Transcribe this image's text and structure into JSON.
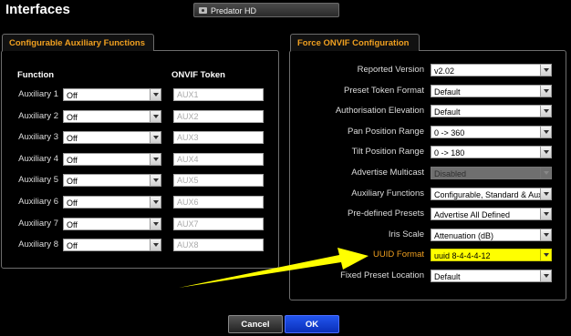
{
  "page": {
    "title": "Interfaces"
  },
  "camera": {
    "name": "Predator HD",
    "icon": "camera-icon"
  },
  "aux_panel": {
    "tab_label": "Configurable Auxiliary Functions",
    "function_header": "Function",
    "token_header": "ONVIF Token",
    "rows": [
      {
        "label": "Auxiliary 1",
        "value": "Off",
        "token": "AUX1"
      },
      {
        "label": "Auxiliary 2",
        "value": "Off",
        "token": "AUX2"
      },
      {
        "label": "Auxiliary 3",
        "value": "Off",
        "token": "AUX3"
      },
      {
        "label": "Auxiliary 4",
        "value": "Off",
        "token": "AUX4"
      },
      {
        "label": "Auxiliary 5",
        "value": "Off",
        "token": "AUX5"
      },
      {
        "label": "Auxiliary 6",
        "value": "Off",
        "token": "AUX6"
      },
      {
        "label": "Auxiliary 7",
        "value": "Off",
        "token": "AUX7"
      },
      {
        "label": "Auxiliary 8",
        "value": "Off",
        "token": "AUX8"
      }
    ]
  },
  "onvif_panel": {
    "tab_label": "Force ONVIF Configuration",
    "rows": [
      {
        "label": "Reported Version",
        "value": "v2.02"
      },
      {
        "label": "Preset Token Format",
        "value": "Default"
      },
      {
        "label": "Authorisation Elevation",
        "value": "Default"
      },
      {
        "label": "Pan Position Range",
        "value": "0 -> 360"
      },
      {
        "label": "Tilt Position Range",
        "value": "0 -> 180"
      },
      {
        "label": "Advertise Multicast",
        "value": "Disabled",
        "disabled": true
      },
      {
        "label": "Auxiliary Functions",
        "value": "Configurable, Standard & Aux"
      },
      {
        "label": "Pre-defined Presets",
        "value": "Advertise All Defined"
      },
      {
        "label": "Iris Scale",
        "value": "Attenuation (dB)"
      },
      {
        "label": "UUID Format",
        "value": "uuid 8-4-4-4-12",
        "highlight": true
      },
      {
        "label": "Fixed Preset Location",
        "value": "Default"
      }
    ]
  },
  "buttons": {
    "cancel": "Cancel",
    "ok": "OK"
  },
  "colors": {
    "accent": "#f0a020",
    "highlight": "#ffff00",
    "ok": "#1a44dd"
  }
}
